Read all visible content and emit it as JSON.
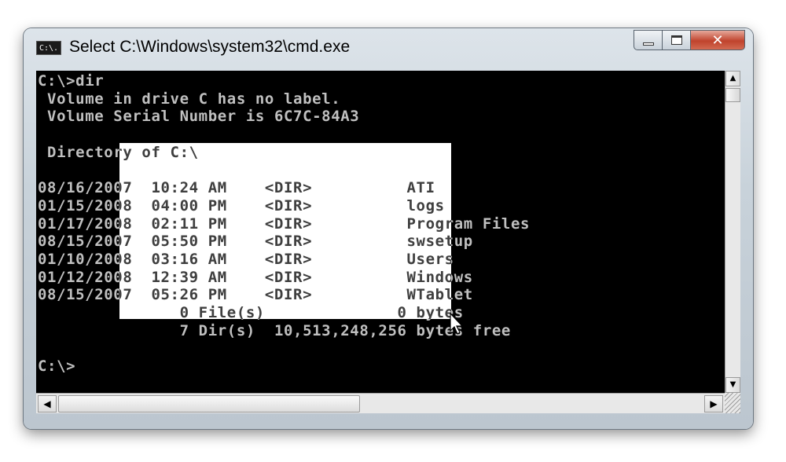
{
  "window": {
    "title": "Select C:\\Windows\\system32\\cmd.exe",
    "app_icon_text": "C:\\.",
    "close_glyph": "✕"
  },
  "console": {
    "lines": [
      "C:\\>dir",
      " Volume in drive C has no label.",
      " Volume Serial Number is 6C7C-84A3",
      "",
      " Directory of C:\\",
      "",
      "08/16/2007  10:24 AM    <DIR>          ATI",
      "01/15/2008  04:00 PM    <DIR>          logs",
      "01/17/2008  02:11 PM    <DIR>          Program Files",
      "08/15/2007  05:50 PM    <DIR>          swsetup",
      "01/10/2008  03:16 AM    <DIR>          Users",
      "01/12/2008  12:39 AM    <DIR>          Windows",
      "08/15/2007  05:26 PM    <DIR>          WTablet",
      "               0 File(s)              0 bytes",
      "               7 Dir(s)  10,513,248,256 bytes free",
      "",
      "C:\\>"
    ]
  },
  "icons": {
    "app": "cmd-icon",
    "minimize": "minimize-icon",
    "maximize": "maximize-icon",
    "close": "close-icon",
    "scroll_up": "arrow-up-icon",
    "scroll_down": "arrow-down-icon",
    "scroll_left": "arrow-left-icon",
    "scroll_right": "arrow-right-icon"
  },
  "colors": {
    "console_bg": "#000000",
    "console_fg": "#c0c0c0",
    "selection": "#ffffff",
    "close_button": "#c0432d"
  }
}
